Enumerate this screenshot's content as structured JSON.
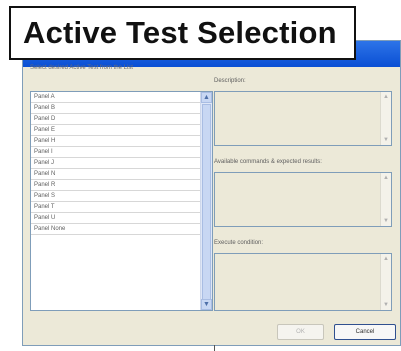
{
  "overlay_title": "Active Test Selection",
  "prompt": "Select desired Active Test from the List",
  "list": {
    "items": [
      "Panel A",
      "Panel B",
      "Panel D",
      "Panel E",
      "Panel H",
      "Panel I",
      "Panel J",
      "Panel N",
      "Panel R",
      "Panel S",
      "Panel T",
      "Panel U",
      "Panel None"
    ]
  },
  "fields": {
    "description_label": "Description:",
    "commands_label": "Available commands & expected results:",
    "execute_label": "Execute condition:"
  },
  "buttons": {
    "ok": "OK",
    "cancel": "Cancel"
  },
  "icons": {
    "scroll_up": "scroll-up-arrow-icon",
    "scroll_down": "scroll-down-arrow-icon"
  },
  "colors": {
    "dialog_bg": "#ece9d8",
    "accent_blue": "#2d74e8",
    "border_blue": "#7f9db9"
  }
}
